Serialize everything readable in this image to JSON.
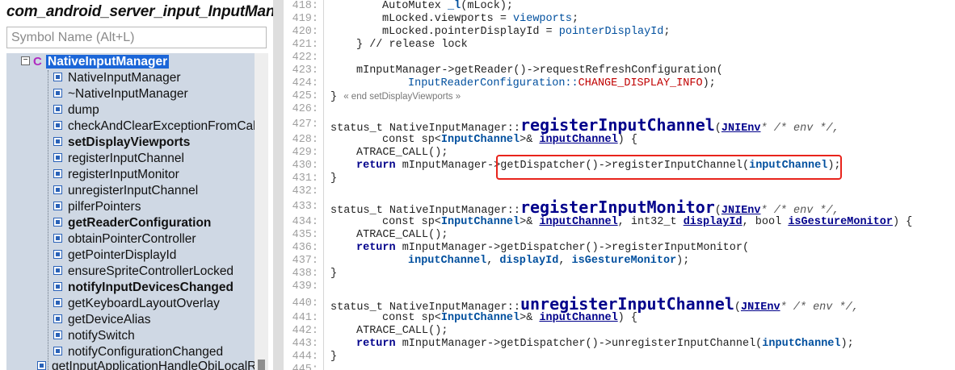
{
  "left_panel": {
    "file_title": "com_android_server_input_InputManagerService.cpp",
    "search_placeholder": "Symbol Name (Alt+L)",
    "root": {
      "label": "NativeInputManager",
      "expander": "−",
      "icon": "C"
    },
    "items": [
      {
        "label": "NativeInputManager",
        "bold": false
      },
      {
        "label": "~NativeInputManager",
        "bold": false
      },
      {
        "label": "dump",
        "bold": false
      },
      {
        "label": "checkAndClearExceptionFromCallback",
        "bold": false
      },
      {
        "label": "setDisplayViewports",
        "bold": true
      },
      {
        "label": "registerInputChannel",
        "bold": false
      },
      {
        "label": "registerInputMonitor",
        "bold": false
      },
      {
        "label": "unregisterInputChannel",
        "bold": false
      },
      {
        "label": "pilferPointers",
        "bold": false
      },
      {
        "label": "getReaderConfiguration",
        "bold": true
      },
      {
        "label": "obtainPointerController",
        "bold": false
      },
      {
        "label": "getPointerDisplayId",
        "bold": false
      },
      {
        "label": "ensureSpriteControllerLocked",
        "bold": false
      },
      {
        "label": "notifyInputDevicesChanged",
        "bold": true
      },
      {
        "label": "getKeyboardLayoutOverlay",
        "bold": false
      },
      {
        "label": "getDeviceAlias",
        "bold": false
      },
      {
        "label": "notifySwitch",
        "bold": false
      },
      {
        "label": "notifyConfigurationChanged",
        "bold": false
      }
    ],
    "partial_item": "getInputApplicationHandleObjLocalRef"
  },
  "code": {
    "line_numbers": [
      "418:",
      "419:",
      "420:",
      "421:",
      "422:",
      "423:",
      "424:",
      "425:",
      "426:",
      "427:",
      "428:",
      "429:",
      "430:",
      "431:",
      "432:",
      "433:",
      "434:",
      "435:",
      "436:",
      "437:",
      "438:",
      "439:",
      "440:",
      "441:",
      "442:",
      "443:",
      "444:",
      "445:"
    ],
    "t_mutex_a": "AutoMutex ",
    "t_l": "_l",
    "t_mlock": "(mLock);",
    "t_viewports_a": "mLocked.viewports = ",
    "t_viewports_b": "viewports",
    "t_semicolon": ";",
    "t_pdid_a": "mLocked.pointerDisplayId = ",
    "t_pdid_b": "pointerDisplayId",
    "t_release": "} // release lock",
    "t_getreader": "mInputManager->getReader()->requestRefreshConfiguration(",
    "t_irc": "InputReaderConfiguration::",
    "t_change": "CHANGE_DISPLAY_INFO",
    "t_close": ");",
    "t_brace_close": "}",
    "t_end_setdv": "« end setDisplayViewports »",
    "t_status": "status_t NativeInputManager::",
    "fn_register_channel": "registerInputChannel",
    "fn_register_monitor": "registerInputMonitor",
    "fn_unregister_channel": "unregisterInputChannel",
    "t_paren": "(",
    "t_jnienv": "JNIEnv",
    "t_env_cmt": "* /* env */,",
    "t_const_sp": "const sp<",
    "t_inputchannel_type": "InputChannel",
    "t_amp": ">& ",
    "t_inputchannel": "inputChannel",
    "t_close_brace_open": ") {",
    "t_comma": ", int32_t ",
    "t_displayid": "displayId",
    "t_bool": ", bool ",
    "t_gesture": "isGestureMonitor",
    "t_atrace": "ATRACE_CALL();",
    "t_return": "return",
    "t_mim": " mInputManager->",
    "t_reg_ch_call": "getDispatcher()->registerInputChannel(",
    "t_reg_mon_call": "getDispatcher()->registerInputMonitor(",
    "t_unreg_call": "getDispatcher()->unregisterInputChannel(",
    "t_comma_sp": ", ",
    "highlight_color": "#e8241c"
  }
}
